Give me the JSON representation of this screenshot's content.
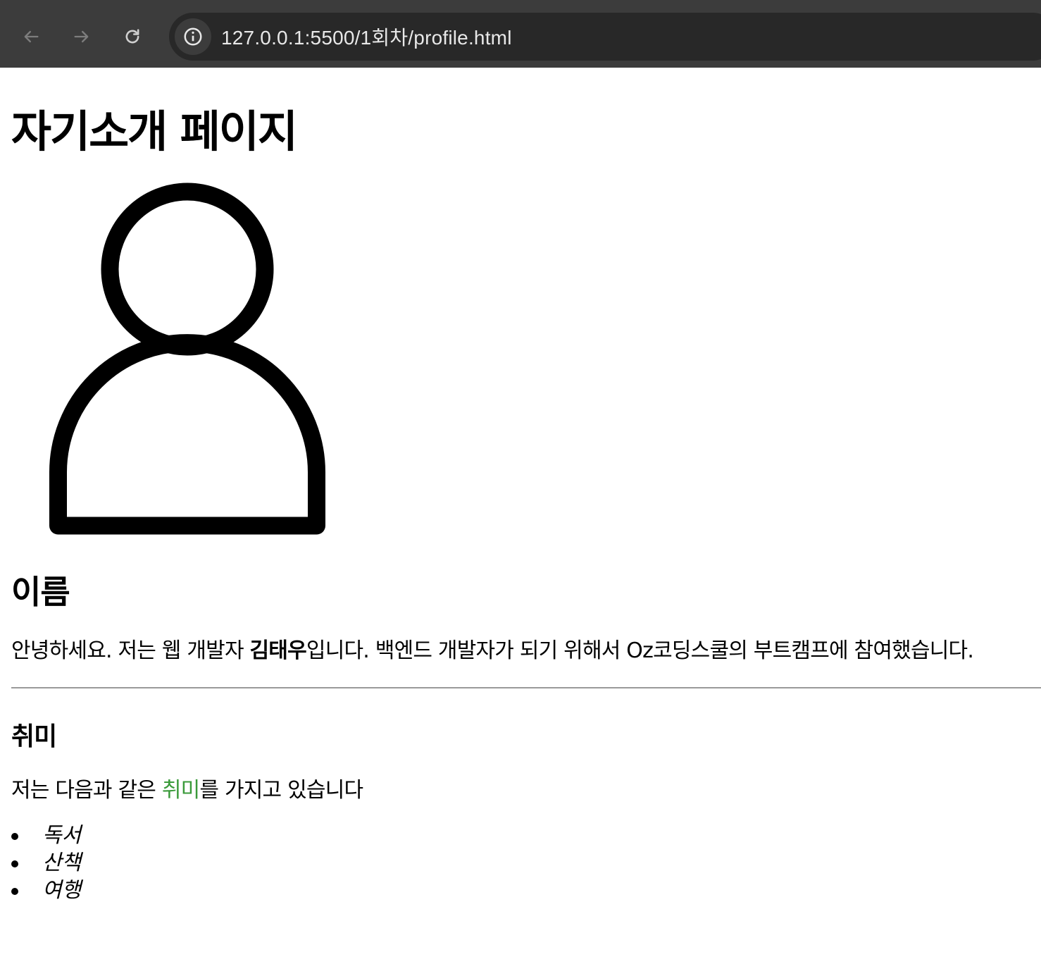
{
  "browser": {
    "url": "127.0.0.1:5500/1회차/profile.html"
  },
  "page": {
    "title": "자기소개 페이지",
    "profile_image_icon": "person-outline-icon",
    "name_heading": "이름",
    "intro": {
      "before": "안녕하세요. 저는 웹 개발자 ",
      "name": "김태우",
      "after": "입니다. 백엔드 개발자가 되기 위해서 Oz코딩스쿨의 부트캠프에 참여했습니다."
    },
    "hobby_heading": "취미",
    "hobby_intro": {
      "before": "저는 다음과 같은 ",
      "highlight": "취미",
      "after": "를 가지고 있습니다"
    },
    "hobbies": [
      "독서",
      "산책",
      "여행"
    ],
    "colors": {
      "highlight": "#3a9a3a",
      "toolbar": "#3c3c3c",
      "omnibox": "#282828"
    }
  }
}
